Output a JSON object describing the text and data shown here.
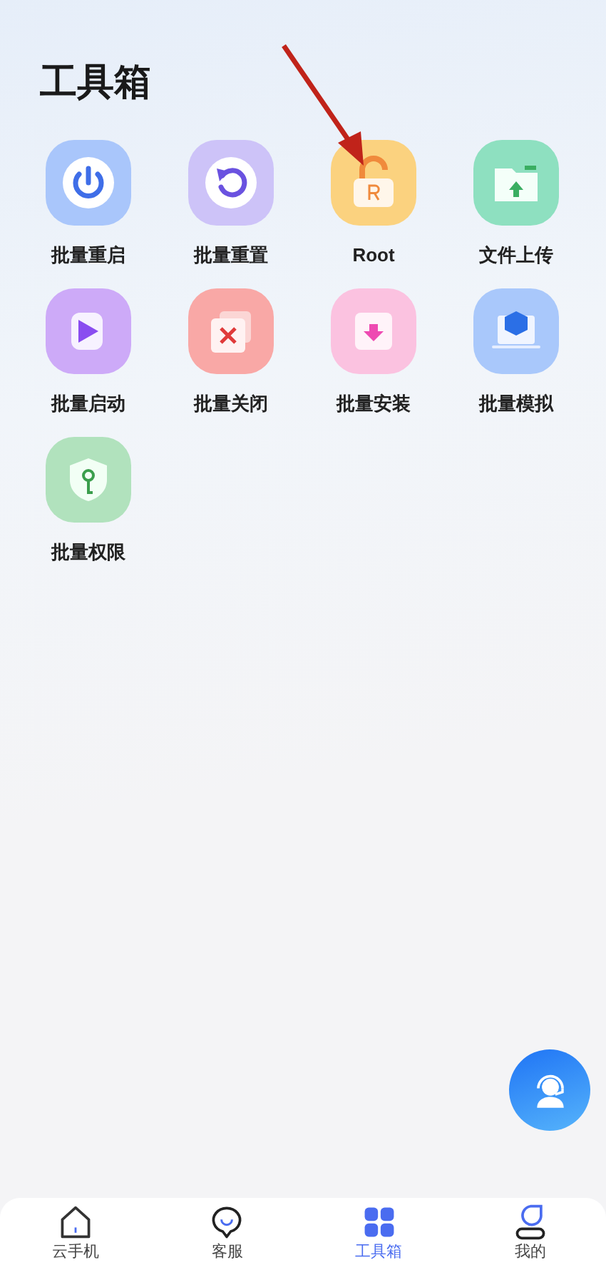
{
  "title": "工具箱",
  "tools": [
    {
      "label": "批量重启",
      "kind": "power",
      "color": "#a9c6fb"
    },
    {
      "label": "批量重置",
      "kind": "reset",
      "color": "#cdc3f8"
    },
    {
      "label": "Root",
      "kind": "lock",
      "color": "#fbd27f"
    },
    {
      "label": "文件上传",
      "kind": "upload",
      "color": "#8ee0c0"
    },
    {
      "label": "批量启动",
      "kind": "play",
      "color": "#cdaaf8"
    },
    {
      "label": "批量关闭",
      "kind": "close",
      "color": "#f9a8a6"
    },
    {
      "label": "批量安装",
      "kind": "install",
      "color": "#fbc2e0"
    },
    {
      "label": "批量模拟",
      "kind": "simulate",
      "color": "#a9c8fb"
    },
    {
      "label": "批量权限",
      "kind": "permission",
      "color": "#b1e2bd"
    }
  ],
  "tabs": [
    {
      "label": "云手机",
      "kind": "home",
      "selected": false
    },
    {
      "label": "客服",
      "kind": "chat",
      "selected": false
    },
    {
      "label": "工具箱",
      "kind": "grid",
      "selected": true
    },
    {
      "label": "我的",
      "kind": "user",
      "selected": false
    }
  ]
}
